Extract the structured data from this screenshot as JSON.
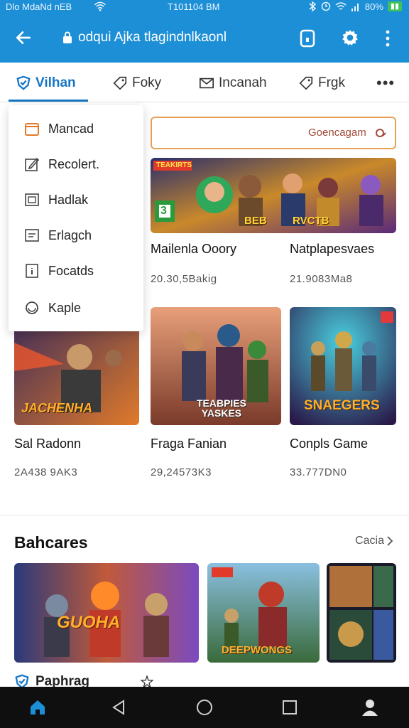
{
  "status_bar": {
    "left_text": "Dlo MdaNd nEB",
    "center_text": "T101104 BM",
    "battery_text": "80%"
  },
  "app_bar": {
    "url_text": "odqui Ajka tlagindnlkaonl"
  },
  "tabs": [
    {
      "label": "Vilhan",
      "icon": "shield-icon",
      "active": true
    },
    {
      "label": "Foky",
      "icon": "tag-icon",
      "active": false
    },
    {
      "label": "Incanah",
      "icon": "envelope-icon",
      "active": false
    },
    {
      "label": "Frgk",
      "icon": "tag-icon",
      "active": false
    }
  ],
  "tabs_more": "•••",
  "search": {
    "text": "Goencagam"
  },
  "dropdown_menu": [
    {
      "label": "Mancad",
      "icon": "folder-icon"
    },
    {
      "label": "Recolert.",
      "icon": "edit-icon"
    },
    {
      "label": "Hadlak",
      "icon": "image-icon"
    },
    {
      "label": "Erlagch",
      "icon": "list-icon"
    },
    {
      "label": "Focatds",
      "icon": "info-icon"
    },
    {
      "label": "Kaple",
      "icon": "circle-icon"
    }
  ],
  "grid_cards": [
    {
      "title": "Mailenla Ooory",
      "meta": "20.30,5Bakig",
      "art_text": "BEB"
    },
    {
      "title": "Natplapesvaes",
      "meta": "21.9083Ma8",
      "art_text": "RVCTB"
    },
    {
      "title": "Sal Radonn",
      "meta": "2A438 9AK3",
      "art_text": "JACHENHA"
    },
    {
      "title": "Fraga Fanian",
      "meta": "29,24573K3",
      "art_text": "TEABPIES YASKES"
    },
    {
      "title": "Conpls Game",
      "meta": "33.777DN0",
      "art_text": "SNAEGERS"
    }
  ],
  "hero_badge": {
    "left": "TEAKIRTS",
    "number": "3"
  },
  "section": {
    "title": "Bahcares",
    "see_all": "Cacia",
    "items": [
      {
        "art_text": "GUOHA"
      },
      {
        "art_text": "DEEPWONGS"
      },
      {
        "art_text": ""
      }
    ]
  },
  "featured_label": "Paphrag",
  "colors": {
    "app_bar": "#1d8fd6",
    "accent": "#1676c4",
    "search_border": "#e7a25a",
    "nav_bar": "#0f0f10"
  }
}
